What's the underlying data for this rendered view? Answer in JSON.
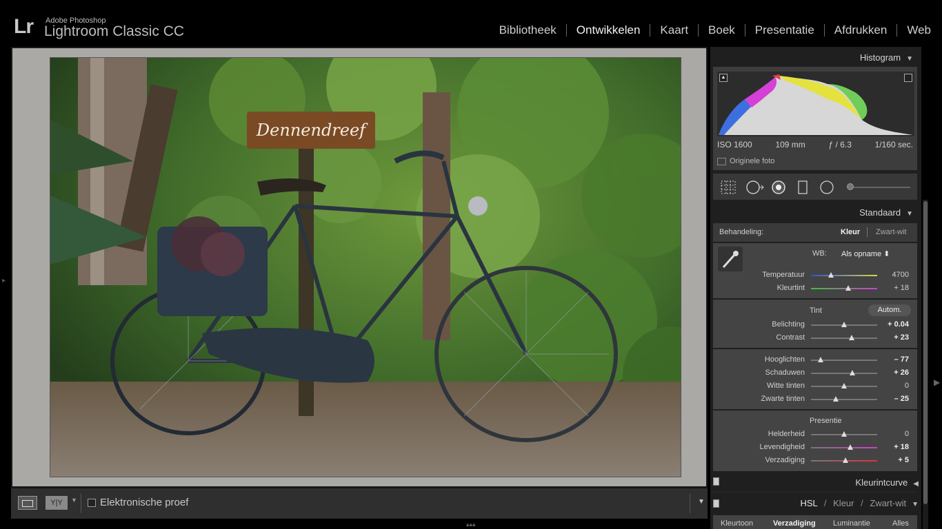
{
  "app": {
    "logo": "Lr",
    "vendor": "Adobe Photoshop",
    "product": "Lightroom Classic CC"
  },
  "modules": [
    "Bibliotheek",
    "Ontwikkelen",
    "Kaart",
    "Boek",
    "Presentatie",
    "Afdrukken",
    "Web"
  ],
  "active_module": "Ontwikkelen",
  "photo": {
    "sign_text": "Dennendreef"
  },
  "toolbar": {
    "yy_label": "Y|Y",
    "soft_proof_label": "Elektronische proef"
  },
  "histogram": {
    "title": "Histogram",
    "iso": "ISO 1600",
    "focal": "109 mm",
    "aperture": "ƒ / 6.3",
    "shutter": "1/160 sec.",
    "original_label": "Originele foto"
  },
  "basic": {
    "title": "Standaard",
    "treatment_label": "Behandeling:",
    "treatment_color": "Kleur",
    "treatment_bw": "Zwart-wit",
    "wb_label": "WB:",
    "wb_value": "Als opname ⬍",
    "tone_label": "Tint",
    "auto_label": "Autom.",
    "presence_label": "Presentie",
    "sliders": [
      {
        "label": "Temperatuur",
        "value": "4700",
        "pos": 0.3,
        "bold": false
      },
      {
        "label": "Kleurtint",
        "value": "+ 18",
        "pos": 0.56,
        "bold": false
      },
      {
        "label": "Belichting",
        "value": "+ 0.04",
        "pos": 0.5,
        "bold": true
      },
      {
        "label": "Contrast",
        "value": "+ 23",
        "pos": 0.61,
        "bold": true
      },
      {
        "label": "Hooglichten",
        "value": "– 77",
        "pos": 0.15,
        "bold": true
      },
      {
        "label": "Schaduwen",
        "value": "+ 26",
        "pos": 0.62,
        "bold": true
      },
      {
        "label": "Witte tinten",
        "value": "0",
        "pos": 0.5,
        "bold": false
      },
      {
        "label": "Zwarte tinten",
        "value": "– 25",
        "pos": 0.38,
        "bold": true
      },
      {
        "label": "Helderheid",
        "value": "0",
        "pos": 0.5,
        "bold": false
      },
      {
        "label": "Levendigheid",
        "value": "+ 18",
        "pos": 0.59,
        "bold": true
      },
      {
        "label": "Verzadiging",
        "value": "+ 5",
        "pos": 0.52,
        "bold": true
      }
    ]
  },
  "tone_curve": {
    "title": "Kleurintcurve"
  },
  "hsl": {
    "title_hsl": "HSL",
    "title_color": "Kleur",
    "title_bw": "Zwart-wit",
    "tabs": [
      "Kleurtoon",
      "Verzadiging",
      "Luminantie",
      "Alles"
    ],
    "active_tab": "Verzadiging"
  },
  "colors": {
    "accent": "#f2f2f2",
    "panel_bg": "#444444",
    "canvas_bg": "#aaa9a5"
  }
}
